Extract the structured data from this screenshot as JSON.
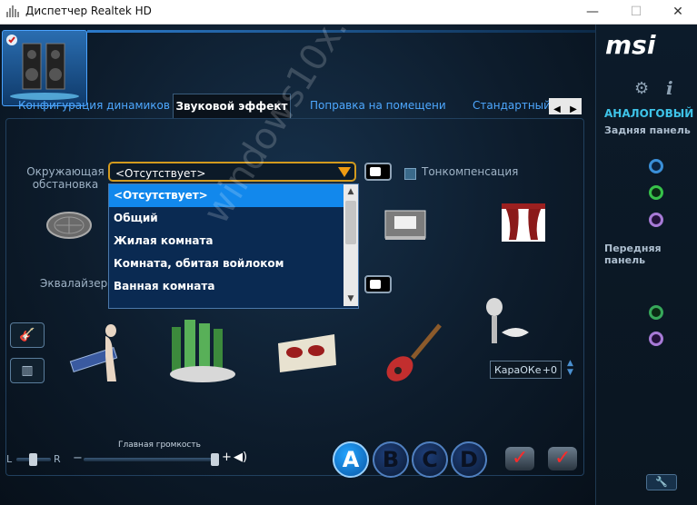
{
  "window": {
    "title": "Диспетчер Realtek HD",
    "controls": {
      "minimize": "—",
      "maximize": "☐",
      "close": "✕"
    }
  },
  "tabs": [
    {
      "label": "Конфигурация динамиков",
      "active": false
    },
    {
      "label": "Звуковой эффект",
      "active": true
    },
    {
      "label": "Поправка на помещение",
      "active": false
    },
    {
      "label": "Стандартный ф",
      "active": false
    }
  ],
  "tab_nav": {
    "prev": "◀",
    "next": "▶"
  },
  "environment": {
    "label_line1": "Окружающая",
    "label_line2": "обстановка",
    "selected": "<Отсутствует>",
    "options": [
      "<Отсутствует>",
      "Общий",
      "Жилая комната",
      "Комната, обитая войлоком",
      "Ванная комната"
    ]
  },
  "loudness": {
    "label": "Тонкомпенсация",
    "checked": false
  },
  "equalizer": {
    "label": "Эквалайзер"
  },
  "karaoke": {
    "label": "КараОКе",
    "value": "+0"
  },
  "volume": {
    "title": "Главная громкость",
    "left": "L",
    "right": "R",
    "minus": "−",
    "plus": "+",
    "level": 0.98
  },
  "presets": [
    "A",
    "B",
    "C",
    "D"
  ],
  "active_preset": "A",
  "right_panel": {
    "brand": "msi",
    "analog_label": "АНАЛОГОВЫЙ",
    "rear_label": "Задняя панель",
    "front_label": "Передняя панель",
    "rear_jacks": [
      "#3a8fd8",
      "#37c24a",
      "#a77ad6"
    ],
    "front_jacks": [
      "#37a85a",
      "#a77ad6"
    ]
  },
  "watermark": "windows10x.ru",
  "colors": {
    "accent": "#1288ec",
    "tab_link": "#4ea8ff",
    "combo_border": "#d29a1e"
  }
}
